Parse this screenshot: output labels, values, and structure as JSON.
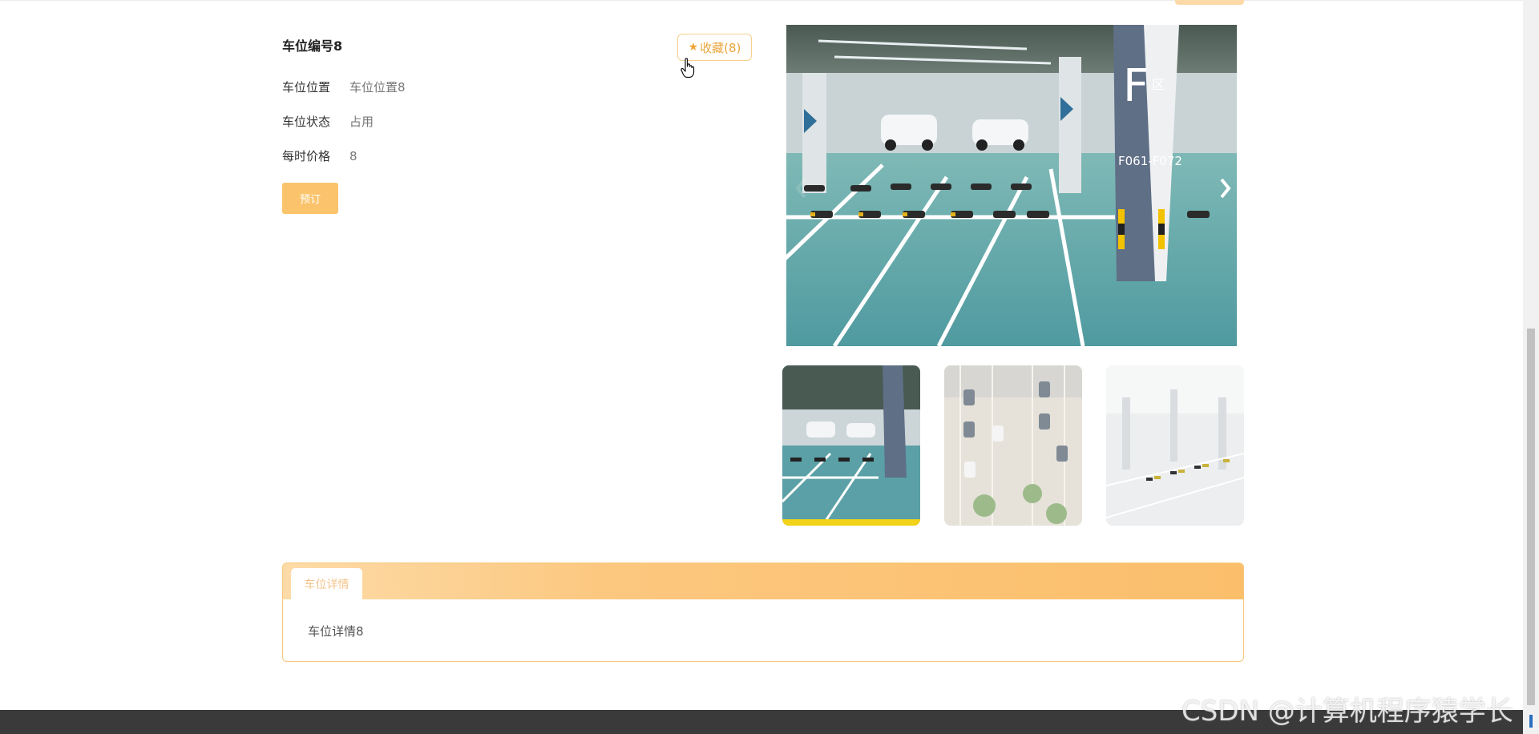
{
  "product": {
    "title": "车位编号8",
    "favorite_label": "收藏(8)",
    "fields": [
      {
        "label": "车位位置",
        "value": "车位位置8"
      },
      {
        "label": "车位状态",
        "value": "占用"
      },
      {
        "label": "每时价格",
        "value": "8"
      }
    ],
    "book_label": "预订"
  },
  "gallery": {
    "main_sign_letter": "F",
    "main_sign_zone": "区",
    "main_sign_code": "F061-F072",
    "thumbnail_count": 3
  },
  "detail": {
    "tab_label": "车位详情",
    "content": "车位详情8"
  },
  "watermark": "CSDN @计算机程序猿学长",
  "colors": {
    "accent": "#fbc46c",
    "favorite": "#e8a63d",
    "footer": "#3a3a3a"
  }
}
